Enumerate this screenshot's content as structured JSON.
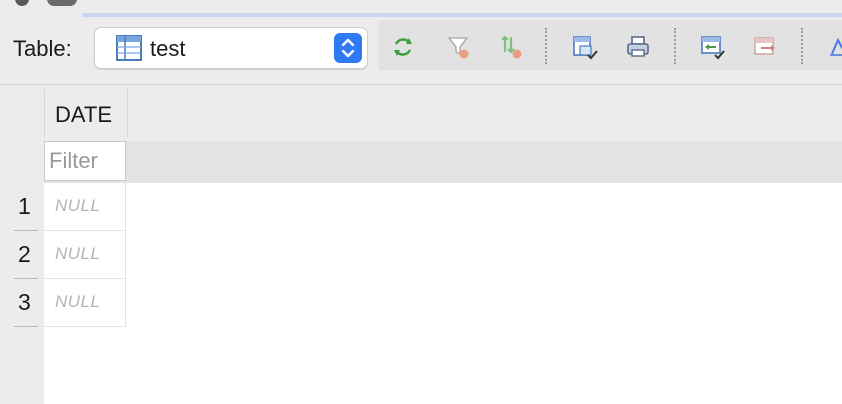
{
  "toolbar": {
    "table_label": "Table:",
    "selected_table": "test",
    "table_icon": "table-icon",
    "buttons": [
      {
        "name": "refresh-icon",
        "color": "#3aa13a"
      },
      {
        "name": "filter-icon",
        "color": "#b0b0b0"
      },
      {
        "name": "sort-icon",
        "color": "#7fbf7f"
      },
      {
        "name": "export-icon",
        "color": "#4a7bbf"
      },
      {
        "name": "print-icon",
        "color": "#5a6a8a"
      },
      {
        "name": "import-icon",
        "color": "#4a9a4a"
      },
      {
        "name": "export-rows-icon",
        "color": "#d08080"
      },
      {
        "name": "chart-icon",
        "color": "#4a7bdf"
      }
    ]
  },
  "grid": {
    "columns": [
      "DATE"
    ],
    "filter_placeholder": "Filter",
    "rows": [
      {
        "num": "1",
        "DATE": "NULL"
      },
      {
        "num": "2",
        "DATE": "NULL"
      },
      {
        "num": "3",
        "DATE": "NULL"
      }
    ]
  },
  "colors": {
    "accent": "#2f7bf6",
    "null_text": "#b4b4b4",
    "window_bg": "#ececec"
  }
}
